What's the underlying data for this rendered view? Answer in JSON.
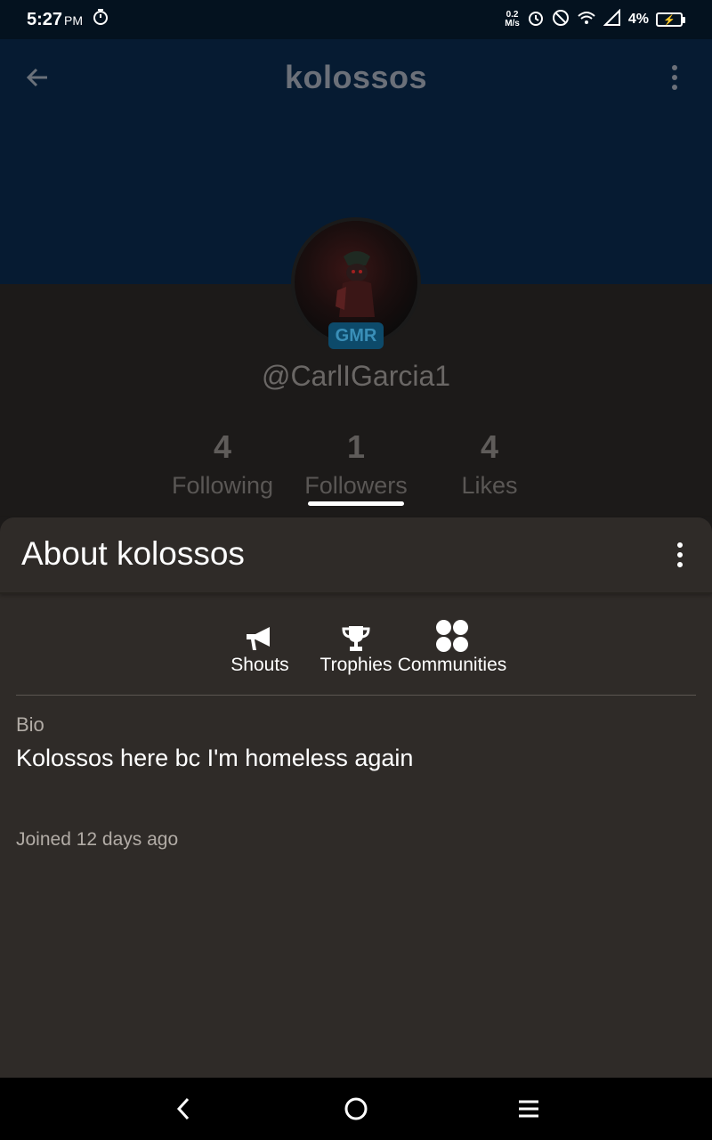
{
  "status": {
    "time": "5:27",
    "ampm": "PM",
    "speed_top": "0.2",
    "speed_bottom": "M/s",
    "battery": "4%"
  },
  "header": {
    "title": "kolossos"
  },
  "profile": {
    "badge": "GMR",
    "handle": "@CarlIGarcia1",
    "stats": [
      {
        "count": "4",
        "label": "Following"
      },
      {
        "count": "1",
        "label": "Followers"
      },
      {
        "count": "4",
        "label": "Likes"
      }
    ]
  },
  "about": {
    "title": "About kolossos",
    "tabs": [
      {
        "label": "Shouts",
        "icon": "megaphone-icon"
      },
      {
        "label": "Trophies",
        "icon": "trophy-icon"
      },
      {
        "label": "Communities",
        "icon": "communities-icon"
      }
    ],
    "bio_label": "Bio",
    "bio_text": "Kolossos here bc I'm homeless again",
    "joined": "Joined 12 days ago"
  },
  "colors": {
    "header_bg": "#061b32",
    "sheet_bg": "#2f2b28",
    "badge_bg": "#0d4a6a"
  }
}
